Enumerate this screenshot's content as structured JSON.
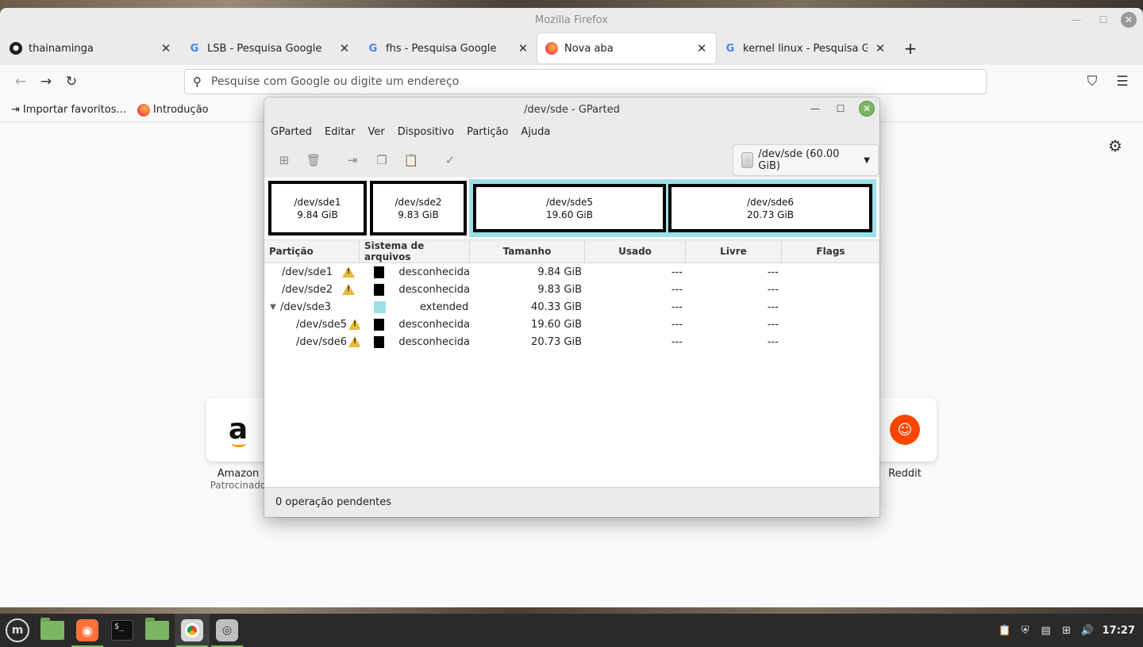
{
  "firefox": {
    "window_title": "Mozilla Firefox",
    "tabs": [
      {
        "label": "thainaminga",
        "favicon": "github-icon",
        "active": false
      },
      {
        "label": "LSB - Pesquisa Google",
        "favicon": "google-icon",
        "active": false
      },
      {
        "label": "fhs - Pesquisa Google",
        "favicon": "google-icon",
        "active": false
      },
      {
        "label": "Nova aba",
        "favicon": "firefox-icon",
        "active": true
      },
      {
        "label": "kernel linux - Pesquisa Google",
        "favicon": "google-icon",
        "active": false
      }
    ],
    "url_placeholder": "Pesquise com Google ou digite um endereço",
    "bookmarks": [
      {
        "label": "Importar favoritos...",
        "icon": "import-icon"
      },
      {
        "label": "Introdução",
        "icon": "firefox-icon"
      }
    ],
    "shortcuts": [
      {
        "name": "Amazon",
        "sub": "Patrocinado",
        "icon": "amazon-logo"
      },
      {
        "name": "Reddit",
        "sub": "",
        "icon": "reddit-logo"
      }
    ]
  },
  "gparted": {
    "title": "/dev/sde - GParted",
    "menu": [
      "GParted",
      "Editar",
      "Ver",
      "Dispositivo",
      "Partição",
      "Ajuda"
    ],
    "toolbar": [
      "new-partition-icon",
      "delete-icon",
      "resize-icon",
      "copy-icon",
      "paste-icon",
      "apply-icon"
    ],
    "device_selector": "/dev/sde (60.00 GiB)",
    "graph": [
      {
        "name": "/dev/sde1",
        "size": "9.84 GiB"
      },
      {
        "name": "/dev/sde2",
        "size": "9.83 GiB"
      },
      {
        "name": "/dev/sde5",
        "size": "19.60 GiB"
      },
      {
        "name": "/dev/sde6",
        "size": "20.73 GiB"
      }
    ],
    "columns": [
      "Partição",
      "Sistema de arquivos",
      "Tamanho",
      "Usado",
      "Livre",
      "Flags"
    ],
    "rows": [
      {
        "partition": "/dev/sde1",
        "warning": true,
        "fs": "desconhecida",
        "fs_color": "#000000",
        "size": "9.84 GiB",
        "used": "---",
        "free": "---",
        "flags": "",
        "indent": 0,
        "expander": false
      },
      {
        "partition": "/dev/sde2",
        "warning": true,
        "fs": "desconhecida",
        "fs_color": "#000000",
        "size": "9.83 GiB",
        "used": "---",
        "free": "---",
        "flags": "",
        "indent": 0,
        "expander": false
      },
      {
        "partition": "/dev/sde3",
        "warning": false,
        "fs": "extended",
        "fs_color": "#9ae0e6",
        "size": "40.33 GiB",
        "used": "---",
        "free": "---",
        "flags": "",
        "indent": 0,
        "expander": true
      },
      {
        "partition": "/dev/sde5",
        "warning": true,
        "fs": "desconhecida",
        "fs_color": "#000000",
        "size": "19.60 GiB",
        "used": "---",
        "free": "---",
        "flags": "",
        "indent": 1,
        "expander": false
      },
      {
        "partition": "/dev/sde6",
        "warning": true,
        "fs": "desconhecida",
        "fs_color": "#000000",
        "size": "20.73 GiB",
        "used": "---",
        "free": "---",
        "flags": "",
        "indent": 1,
        "expander": false
      }
    ],
    "status": "0 operação pendentes"
  },
  "taskbar": {
    "clock": "17:27",
    "apps": [
      "mint-menu-icon",
      "folder-icon",
      "firefox-icon",
      "terminal-icon",
      "files-icon",
      "chromium-icon",
      "gparted-icon"
    ]
  }
}
